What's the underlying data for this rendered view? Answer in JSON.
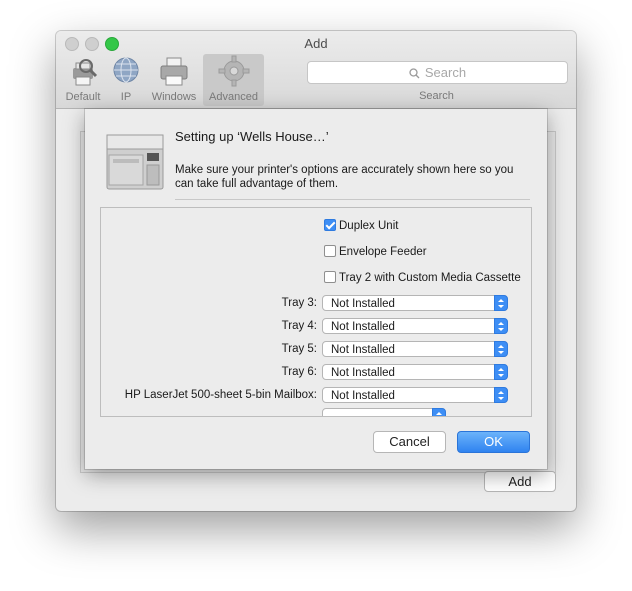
{
  "window": {
    "title": "Add",
    "toolbar": {
      "items": [
        {
          "label": "Default",
          "icon": "default-printer-icon"
        },
        {
          "label": "IP",
          "icon": "globe-icon"
        },
        {
          "label": "Windows",
          "icon": "windows-printer-icon"
        },
        {
          "label": "Advanced",
          "icon": "gear-icon",
          "selected": true
        }
      ],
      "search": {
        "placeholder": "Search",
        "label": "Search"
      }
    },
    "add_button": "Add"
  },
  "sheet": {
    "title": "Setting up ‘Wells House…’",
    "description": "Make sure your printer's options are accurately shown here so you can take full advantage of them.",
    "checkboxes": [
      {
        "label": "Duplex Unit",
        "checked": true
      },
      {
        "label": "Envelope Feeder",
        "checked": false
      },
      {
        "label": "Tray 2 with Custom Media Cassette",
        "checked": false
      }
    ],
    "popups": [
      {
        "label": "Tray 3:",
        "value": "Not Installed"
      },
      {
        "label": "Tray 4:",
        "value": "Not Installed"
      },
      {
        "label": "Tray 5:",
        "value": "Not Installed"
      },
      {
        "label": "Tray 6:",
        "value": "Not Installed"
      },
      {
        "label": "HP LaserJet 500-sheet 5-bin Mailbox:",
        "value": "Not Installed"
      }
    ],
    "cancel_label": "Cancel",
    "ok_label": "OK"
  },
  "colors": {
    "accent": "#3d8ef5",
    "zoom_button": "#34c748"
  }
}
